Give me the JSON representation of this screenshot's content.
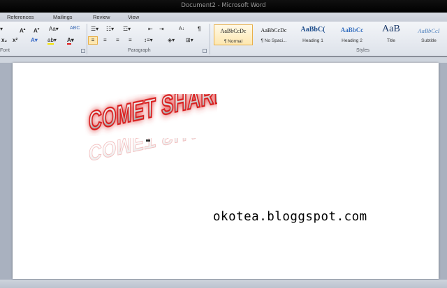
{
  "window": {
    "title": "Document2 - Microsoft Word"
  },
  "tabs": [
    "References",
    "Mailings",
    "Review",
    "View"
  ],
  "ribbon": {
    "groups": {
      "font": "Font",
      "paragraph": "Paragraph",
      "styles": "Styles"
    },
    "styles": [
      {
        "sample": "AaBbCcDc",
        "name": "¶ Normal",
        "selected": true
      },
      {
        "sample": "AaBbCcDc",
        "name": "¶ No Spaci...",
        "selected": false
      },
      {
        "sample": "AaBbC(",
        "name": "Heading 1",
        "selected": false
      },
      {
        "sample": "AaBbCc",
        "name": "Heading 2",
        "selected": false
      },
      {
        "sample": "AaB",
        "name": "Title",
        "selected": false
      },
      {
        "sample": "AaBbCcI",
        "name": "Subtitle",
        "selected": false
      }
    ]
  },
  "document": {
    "wordart_text": "COMET SHARE",
    "body_text": "okotea.bloggspot.com"
  },
  "colors": {
    "wordart_red": "#d81e1e",
    "accent_highlight": "#e8b04a"
  }
}
